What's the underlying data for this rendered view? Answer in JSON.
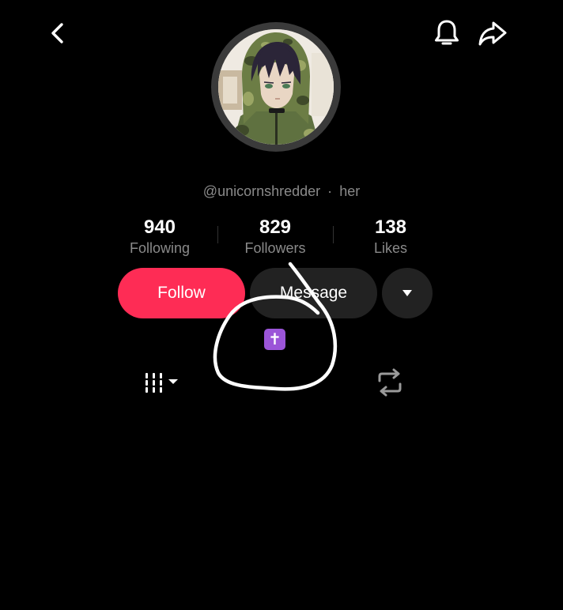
{
  "profile": {
    "handle": "@unicornshredder",
    "separator": "·",
    "pronouns": "her",
    "avatar_icon": "anime-avatar-camo-hoodie"
  },
  "stats": {
    "following": {
      "value": "940",
      "label": "Following"
    },
    "followers": {
      "value": "829",
      "label": "Followers"
    },
    "likes": {
      "value": "138",
      "label": "Likes"
    }
  },
  "actions": {
    "follow_label": "Follow",
    "message_label": "Message",
    "more_icon": "caret-down-icon"
  },
  "bio": {
    "emoji": "✝"
  },
  "topbar": {
    "back_icon": "chevron-left-icon",
    "bell_icon": "bell-icon",
    "share_icon": "share-arrow-icon"
  },
  "tabs": {
    "videos_icon": "grid-icon",
    "reposts_icon": "repost-icon"
  },
  "colors": {
    "background": "#000000",
    "follow": "#fe2c55",
    "secondary_button": "#222222",
    "muted_text": "#8a8a8a",
    "emoji_bg": "#9b55d8"
  }
}
